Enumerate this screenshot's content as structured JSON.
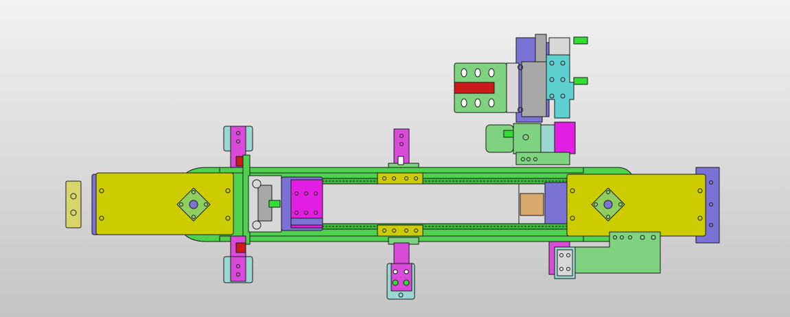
{
  "viewport": {
    "background_top": "#f2f2f2",
    "background_bottom": "#c4c4c4"
  },
  "palette": {
    "outline": "#1a1a1a",
    "frame_green": "#4fd14f",
    "frame_green_dark": "#3fb83f",
    "plate_yellow": "#cccc00",
    "plate_yellow_light": "#d8d66a",
    "motor_mount_green": "#8fcf5f",
    "bracket_magenta": "#d94ad9",
    "block_magenta": "#e21ee2",
    "plate_purple": "#7b72d6",
    "cyan_block": "#5fd0d0",
    "light_green": "#7fd27f",
    "red_band": "#cc1a1a",
    "gray_part": "#a8a8a8",
    "light_gray": "#d8d8d8",
    "tan_block": "#d9a86c",
    "pale_cyan": "#9ad7d0",
    "fitting_green": "#33dd33"
  },
  "parts": [
    {
      "name": "end-cap-plate",
      "color": "plate_yellow_light"
    },
    {
      "name": "belt-conveyor-frame",
      "color": "frame_green"
    },
    {
      "name": "left-end-plate",
      "color": "plate_yellow"
    },
    {
      "name": "right-end-plate",
      "color": "plate_yellow"
    },
    {
      "name": "pulley-mount-left",
      "color": "motor_mount_green"
    },
    {
      "name": "pulley-mount-right",
      "color": "motor_mount_green"
    },
    {
      "name": "carriage-block",
      "color": "block_magenta"
    },
    {
      "name": "belt-tensioner",
      "color": "light_gray"
    },
    {
      "name": "idler-block",
      "color": "tan_block"
    },
    {
      "name": "support-bracket-left-top",
      "color": "bracket_magenta"
    },
    {
      "name": "support-bracket-left-bottom",
      "color": "bracket_magenta"
    },
    {
      "name": "support-bracket-mid-top",
      "color": "bracket_magenta"
    },
    {
      "name": "support-bracket-mid-bottom",
      "color": "bracket_magenta"
    },
    {
      "name": "support-bracket-right-bottom",
      "color": "bracket_magenta"
    },
    {
      "name": "gripper-assembly",
      "color": "plate_purple"
    },
    {
      "name": "motor-bracket",
      "color": "light_green"
    }
  ]
}
